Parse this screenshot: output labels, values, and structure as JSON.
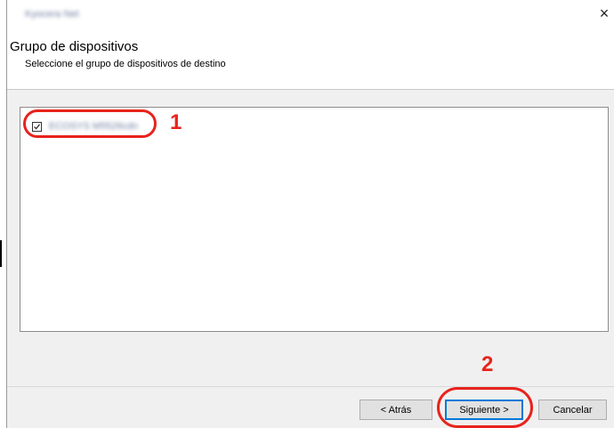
{
  "window": {
    "title": "Kyocera Net",
    "close_glyph": "×"
  },
  "header": {
    "title": "Grupo de dispositivos",
    "subtitle": "Seleccione el grupo de dispositivos de destino"
  },
  "device_list": {
    "items": [
      {
        "label": "ECOSYS M5526cdn",
        "checked": true
      }
    ]
  },
  "annotations": {
    "callout_1": "1",
    "callout_2": "2",
    "color": "#e8231c"
  },
  "buttons": {
    "back_label": "< Atrás",
    "next_label": "Siguiente >",
    "cancel_label": "Cancelar"
  }
}
